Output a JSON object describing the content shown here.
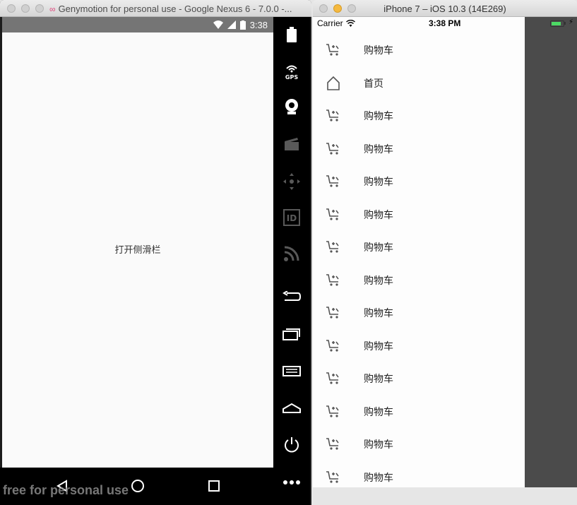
{
  "genymotion": {
    "window_title": "Genymotion for personal use - Google Nexus 6 - 7.0.0 -...",
    "status_time": "3:38",
    "open_drawer_label": "打开侧滑栏",
    "watermark": "free for personal use",
    "toolbar": [
      {
        "name": "battery-icon",
        "enabled": true
      },
      {
        "name": "gps-icon",
        "label": "GPS",
        "enabled": true
      },
      {
        "name": "webcam-icon",
        "enabled": true
      },
      {
        "name": "screencast-icon",
        "enabled": false
      },
      {
        "name": "dpad-icon",
        "enabled": false
      },
      {
        "name": "device-id-icon",
        "label": "ID",
        "enabled": false
      },
      {
        "name": "network-icon",
        "enabled": false
      },
      {
        "name": "back-icon",
        "enabled": true
      },
      {
        "name": "recent-apps-icon",
        "enabled": true
      },
      {
        "name": "menu-icon",
        "enabled": true
      },
      {
        "name": "home-icon",
        "enabled": true
      },
      {
        "name": "power-icon",
        "enabled": true
      },
      {
        "name": "more-icon",
        "enabled": true
      }
    ]
  },
  "simulator": {
    "window_title": "iPhone 7 – iOS 10.3 (14E269)",
    "carrier": "Carrier",
    "time": "3:38 PM",
    "menu_items": [
      {
        "icon": "cart-icon",
        "label": "购物车"
      },
      {
        "icon": "home-icon",
        "label": "首页"
      },
      {
        "icon": "cart-icon",
        "label": "购物车"
      },
      {
        "icon": "cart-icon",
        "label": "购物车"
      },
      {
        "icon": "cart-icon",
        "label": "购物车"
      },
      {
        "icon": "cart-icon",
        "label": "购物车"
      },
      {
        "icon": "cart-icon",
        "label": "购物车"
      },
      {
        "icon": "cart-icon",
        "label": "购物车"
      },
      {
        "icon": "cart-icon",
        "label": "购物车"
      },
      {
        "icon": "cart-icon",
        "label": "购物车"
      },
      {
        "icon": "cart-icon",
        "label": "购物车"
      },
      {
        "icon": "cart-icon",
        "label": "购物车"
      },
      {
        "icon": "cart-icon",
        "label": "购物车"
      },
      {
        "icon": "cart-icon",
        "label": "购物车"
      }
    ]
  },
  "colors": {
    "android_status_bar": "#757575",
    "ios_menu_bg": "#fdfdfd",
    "ios_overlay": "#4b4b4b",
    "battery_green": "#4cd964"
  }
}
